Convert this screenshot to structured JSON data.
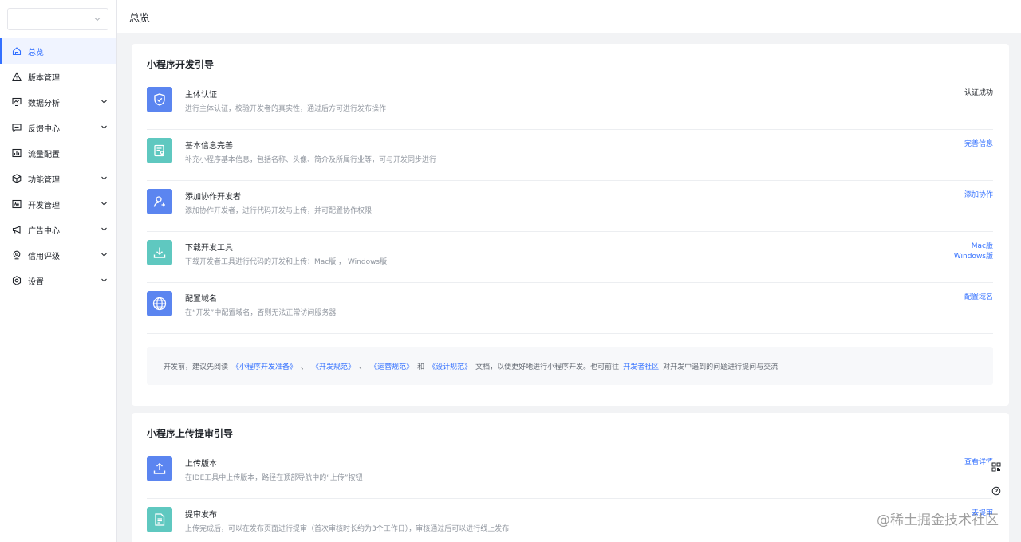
{
  "header": {
    "title": "总览"
  },
  "app_select": {
    "value": ""
  },
  "sidebar": {
    "items": [
      {
        "label": "总览",
        "icon": "home-icon",
        "active": true,
        "expandable": false
      },
      {
        "label": "版本管理",
        "icon": "warning-triangle-icon",
        "active": false,
        "expandable": false
      },
      {
        "label": "数据分析",
        "icon": "analytics-monitor-icon",
        "active": false,
        "expandable": true
      },
      {
        "label": "反馈中心",
        "icon": "feedback-message-icon",
        "active": false,
        "expandable": true
      },
      {
        "label": "流量配置",
        "icon": "traffic-chart-icon",
        "active": false,
        "expandable": false
      },
      {
        "label": "功能管理",
        "icon": "cube-icon",
        "active": false,
        "expandable": true
      },
      {
        "label": "开发管理",
        "icon": "code-window-icon",
        "active": false,
        "expandable": true
      },
      {
        "label": "广告中心",
        "icon": "megaphone-icon",
        "active": false,
        "expandable": true
      },
      {
        "label": "信用评级",
        "icon": "credit-badge-icon",
        "active": false,
        "expandable": true
      },
      {
        "label": "设置",
        "icon": "gear-icon",
        "active": false,
        "expandable": true
      }
    ]
  },
  "dev_guide": {
    "title": "小程序开发引导",
    "steps": [
      {
        "name": "主体认证",
        "desc": "进行主体认证，校验开发者的真实性，通过后方可进行发布操作",
        "action": "认证成功",
        "icon": "shield-check-icon",
        "color": "#5b85f0"
      },
      {
        "name": "基本信息完善",
        "desc": "补充小程序基本信息，包括名称、头像、简介及所属行业等，可与开发同步进行",
        "action": "完善信息",
        "icon": "profile-card-icon",
        "color": "#5fc8c0"
      },
      {
        "name": "添加协作开发者",
        "desc": "添加协作开发者，进行代码开发与上传，并可配置协作权限",
        "action": "添加协作",
        "icon": "add-user-icon",
        "color": "#5b85f0"
      },
      {
        "name": "下载开发工具",
        "desc": "下载开发者工具进行代码的开发和上传：Mac版 ， Windows版",
        "action": "Mac版",
        "action2": "Windows版",
        "icon": "download-icon",
        "color": "#5fc8c0"
      },
      {
        "name": "配置域名",
        "desc": "在“开发”中配置域名，否则无法正常访问服务器",
        "action": "配置域名",
        "icon": "globe-icon",
        "color": "#5b85f0"
      }
    ],
    "tip": {
      "prefix": "开发前，建议先阅读",
      "link1": "《小程序开发准备》",
      "sep1": "、",
      "link2": "《开发规范》",
      "sep2": "、",
      "link3": "《运营规范》",
      "and": "和",
      "link4": "《设计规范》",
      "middle": "文档，以便更好地进行小程序开发。也可前往",
      "link5": "开发者社区",
      "suffix": "对开发中遇到的问题进行提问与交流"
    }
  },
  "upload_guide": {
    "title": "小程序上传提审引导",
    "steps": [
      {
        "name": "上传版本",
        "desc": "在IDE工具中上传版本，路径在顶部导航中的“上传”按钮",
        "action": "查看详情",
        "icon": "upload-icon",
        "color": "#5b85f0"
      },
      {
        "name": "提审发布",
        "desc": "上传完成后，可以在发布页面进行提审（首次审核时长约为3个工作日），审核通过后可以进行线上发布",
        "action": "去提审",
        "icon": "document-icon",
        "color": "#5fc8c0"
      }
    ]
  },
  "watermark": "@稀土掘金技术社区"
}
